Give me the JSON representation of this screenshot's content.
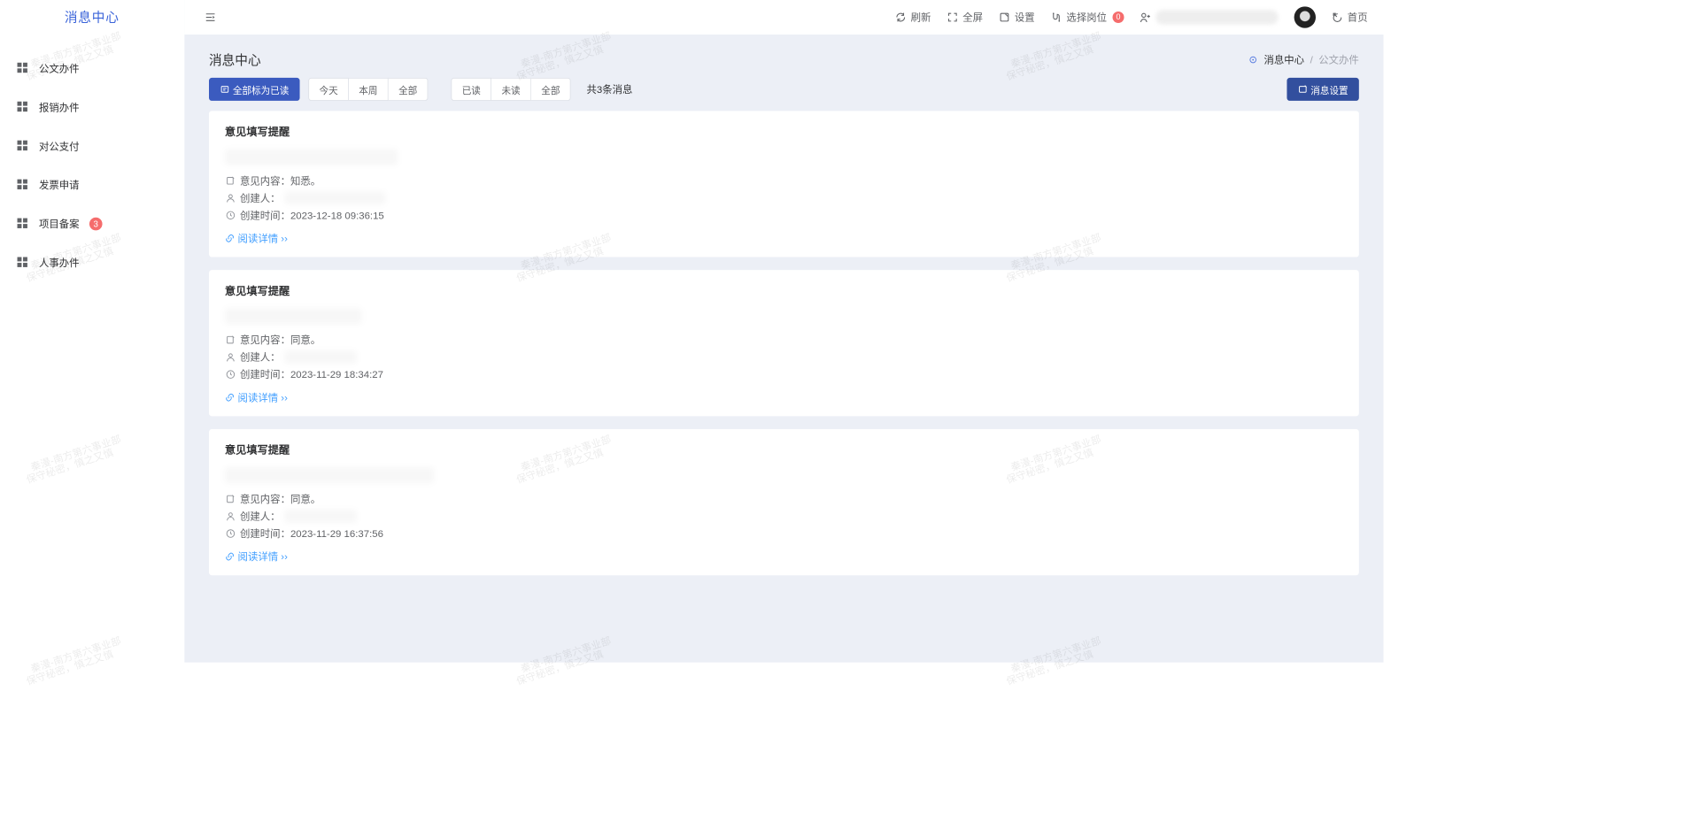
{
  "brand": "消息中心",
  "watermark": {
    "line1": "秦漫-南方第六事业部",
    "line2": "保守秘密，慎之又慎"
  },
  "sidebar": {
    "items": [
      {
        "label": "公文办件",
        "badge": null
      },
      {
        "label": "报销办件",
        "badge": null
      },
      {
        "label": "对公支付",
        "badge": null
      },
      {
        "label": "发票申请",
        "badge": null
      },
      {
        "label": "项目备案",
        "badge": "3"
      },
      {
        "label": "人事办件",
        "badge": null
      }
    ]
  },
  "topbar": {
    "refresh": "刷新",
    "fullscreen": "全屏",
    "settings": "设置",
    "select_post": "选择岗位",
    "select_post_badge": "0",
    "home": "首页"
  },
  "page": {
    "title": "消息中心",
    "breadcrumb": {
      "current": "消息中心",
      "sub": "公文办件"
    },
    "mark_all": "全部标为已读",
    "time_filter": [
      "今天",
      "本周",
      "全部"
    ],
    "read_filter": [
      "已读",
      "未读",
      "全部"
    ],
    "count_text": "共3条消息",
    "msg_settings": "消息设置"
  },
  "labels": {
    "opinion_prefix": "意见内容：",
    "creator_prefix": "创建人：",
    "created_prefix": "创建时间：",
    "read_more": "阅读详情"
  },
  "messages": [
    {
      "title": "意见填写提醒",
      "opinion": "知悉。",
      "created_at": "2023-12-18 09:36:15"
    },
    {
      "title": "意见填写提醒",
      "opinion": "同意。",
      "created_at": "2023-11-29 18:34:27"
    },
    {
      "title": "意见填写提醒",
      "opinion": "同意。",
      "created_at": "2023-11-29 16:37:56"
    }
  ]
}
